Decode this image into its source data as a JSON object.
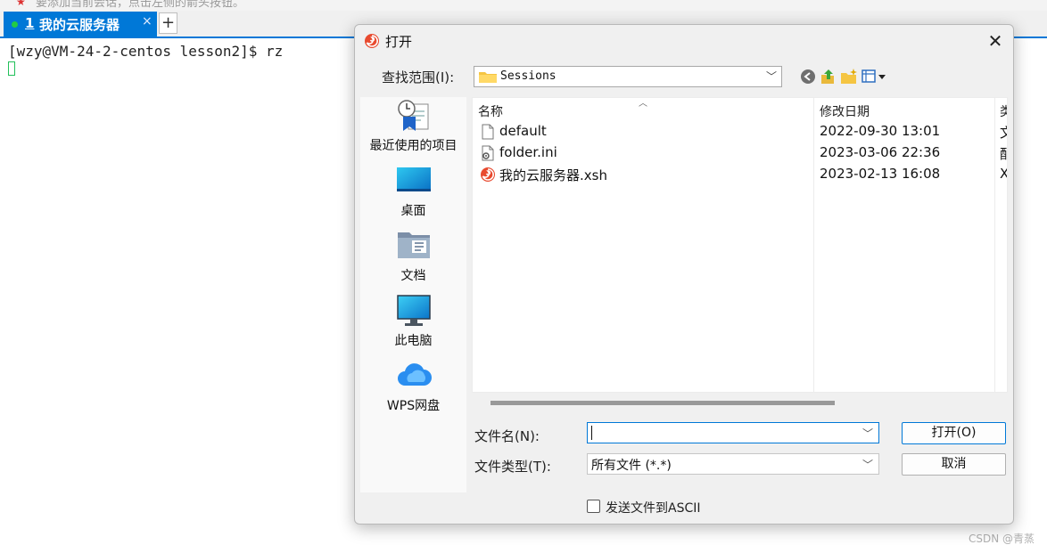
{
  "app": {
    "top_hint": "要添加当前会话，点击左侧的箭头按钮。",
    "tab": {
      "number": "1",
      "label": "我的云服务器",
      "close": "×"
    },
    "add_tab": "+",
    "terminal_prompt": "[wzy@VM-24-2-centos lesson2]$ rz",
    "watermark": "CSDN @青蒸"
  },
  "dialog": {
    "title": "打开",
    "close": "✕",
    "look_in_label": "查找范围(I):",
    "look_in_value": "Sessions",
    "places": [
      {
        "label": "最近使用的项目",
        "icon": "recent-items-icon"
      },
      {
        "label": "桌面",
        "icon": "desktop-icon"
      },
      {
        "label": "文档",
        "icon": "documents-icon"
      },
      {
        "label": "此电脑",
        "icon": "this-pc-icon"
      },
      {
        "label": "WPS网盘",
        "icon": "wps-cloud-icon"
      }
    ],
    "columns": {
      "name": "名称",
      "date": "修改日期",
      "type": "类"
    },
    "files": [
      {
        "name": "default",
        "date": "2022-09-30 13:01",
        "type": "文",
        "icon": "file-icon"
      },
      {
        "name": "folder.ini",
        "date": "2023-03-06 22:36",
        "type": "配",
        "icon": "settings-file-icon"
      },
      {
        "name": "我的云服务器.xsh",
        "date": "2023-02-13 16:08",
        "type": "X",
        "icon": "xshell-file-icon"
      }
    ],
    "file_name_label": "文件名(N):",
    "file_name_value": "",
    "file_type_label": "文件类型(T):",
    "file_type_value": "所有文件 (*.*)",
    "open_button": "打开(O)",
    "cancel_button": "取消",
    "ascii_label": "发送文件到ASCII"
  },
  "colors": {
    "accent": "#0078d7",
    "cursor": "#22c05a",
    "dialog_bg": "#f0f0f0"
  }
}
